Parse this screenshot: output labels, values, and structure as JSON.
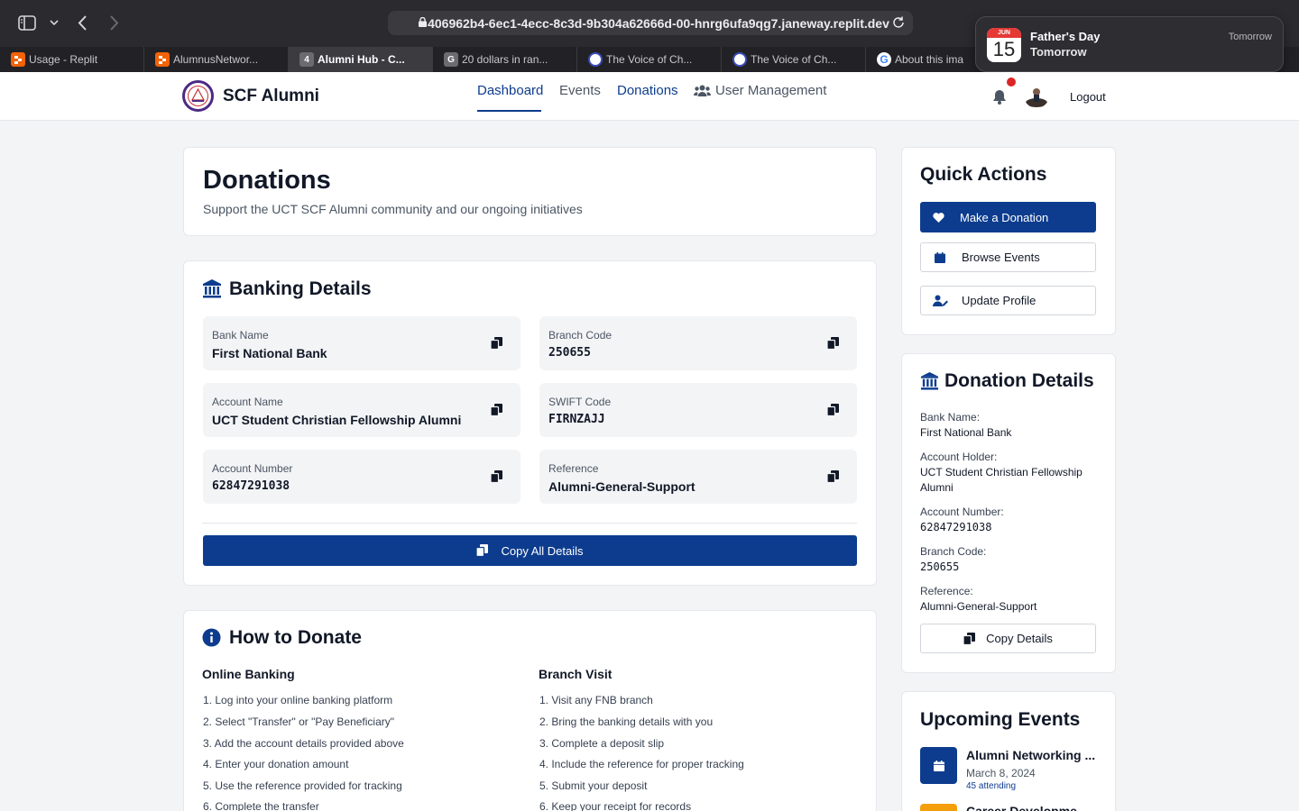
{
  "browser": {
    "url": "406962b4-6ec1-4ecc-8c3d-9b304a62666d-00-hnrg6ufa9qg7.janeway.replit.dev",
    "tabs": [
      {
        "label": "Usage - Replit",
        "favicon_text": "",
        "favicon_color": "#f26207"
      },
      {
        "label": "AlumnusNetwor...",
        "favicon_text": "",
        "favicon_color": "#f26207"
      },
      {
        "label": "Alumni Hub - C...",
        "favicon_text": "4",
        "favicon_color": "#6b6b70"
      },
      {
        "label": "20 dollars in ran...",
        "favicon_text": "G",
        "favicon_color": "#6b6b70"
      },
      {
        "label": "The Voice of Ch...",
        "favicon_text": "",
        "favicon_color": "#3b4cb8"
      },
      {
        "label": "The Voice of Ch...",
        "favicon_text": "",
        "favicon_color": "#3b4cb8"
      },
      {
        "label": "About this ima",
        "favicon_text": "G",
        "favicon_color": "#4285f4"
      }
    ]
  },
  "notification": {
    "month": "JUN",
    "day": "15",
    "title": "Father's Day",
    "subtitle": "Tomorrow",
    "time": "Tomorrow"
  },
  "header": {
    "brand": "SCF Alumni",
    "nav": [
      "Dashboard",
      "Events",
      "Donations",
      "User Management"
    ],
    "logout": "Logout"
  },
  "intro": {
    "title": "Donations",
    "subtitle": "Support the UCT SCF Alumni community and our ongoing initiatives"
  },
  "banking": {
    "title": "Banking Details",
    "fields": [
      {
        "label": "Bank Name",
        "value": "First National Bank"
      },
      {
        "label": "Branch Code",
        "value": "250655"
      },
      {
        "label": "Account Name",
        "value": "UCT Student Christian Fellowship Alumni"
      },
      {
        "label": "SWIFT Code",
        "value": "FIRNZAJJ"
      },
      {
        "label": "Account Number",
        "value": "62847291038"
      },
      {
        "label": "Reference",
        "value": "Alumni-General-Support"
      }
    ],
    "copy_all": "Copy All Details"
  },
  "how": {
    "title": "How to Donate",
    "online_title": "Online Banking",
    "online_steps": [
      "1. Log into your online banking platform",
      "2. Select \"Transfer\" or \"Pay Beneficiary\"",
      "3. Add the account details provided above",
      "4. Enter your donation amount",
      "5. Use the reference provided for tracking",
      "6. Complete the transfer"
    ],
    "branch_title": "Branch Visit",
    "branch_steps": [
      "1. Visit any FNB branch",
      "2. Bring the banking details with you",
      "3. Complete a deposit slip",
      "4. Include the reference for proper tracking",
      "5. Submit your deposit",
      "6. Keep your receipt for records"
    ]
  },
  "quick_actions": {
    "title": "Quick Actions",
    "donate": "Make a Donation",
    "browse": "Browse Events",
    "update": "Update Profile"
  },
  "donation_details": {
    "title": "Donation Details",
    "bank_label": "Bank Name:",
    "bank_value": "First National Bank",
    "holder_label": "Account Holder:",
    "holder_value_1": "UCT Student Christian Fellowship",
    "holder_value_2": "Alumni",
    "acct_label": "Account Number:",
    "acct_value": "62847291038",
    "branch_label": "Branch Code:",
    "branch_value": "250655",
    "ref_label": "Reference:",
    "ref_value": "Alumni-General-Support",
    "copy": "Copy Details"
  },
  "events": {
    "title": "Upcoming Events",
    "items": [
      {
        "name": "Alumni Networking ...",
        "date": "March 8, 2024",
        "attending": "45 attending"
      },
      {
        "name": "Career Developme...",
        "date": "",
        "attending": ""
      }
    ]
  },
  "colors": {
    "primary": "#0d3c8e",
    "alert": "#dc2626",
    "secondary_event": "#f59e0b"
  }
}
